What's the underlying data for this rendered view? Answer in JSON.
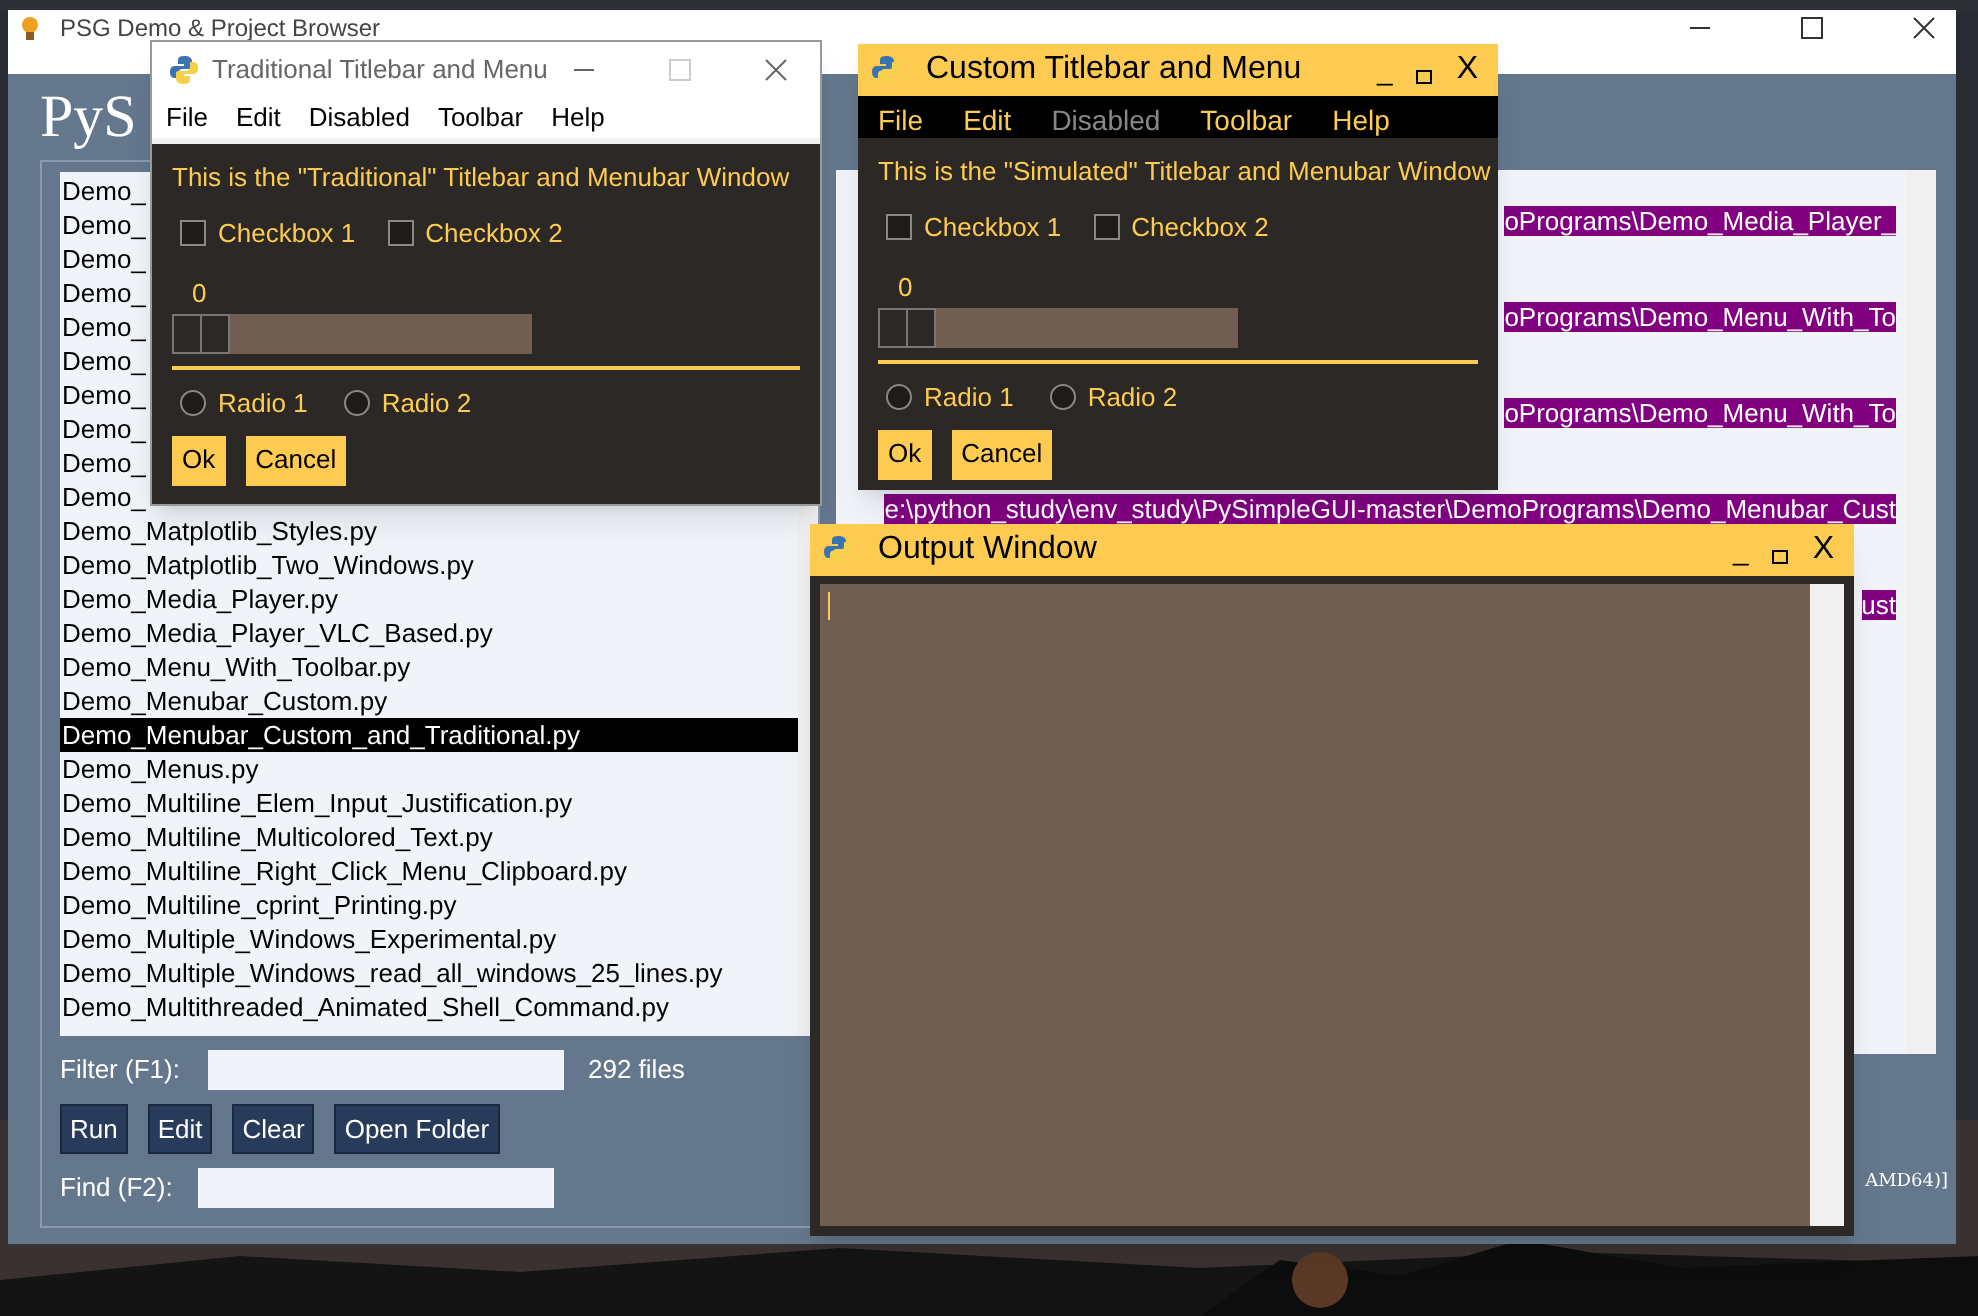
{
  "main_window": {
    "title": "PSG Demo & Project Browser",
    "heading": "PyS",
    "file_list": [
      {
        "text": "Demo_",
        "selected": false
      },
      {
        "text": "Demo_",
        "selected": false
      },
      {
        "text": "Demo_",
        "selected": false
      },
      {
        "text": "Demo_",
        "selected": false
      },
      {
        "text": "Demo_",
        "selected": false
      },
      {
        "text": "Demo_",
        "selected": false
      },
      {
        "text": "Demo_",
        "selected": false
      },
      {
        "text": "Demo_",
        "selected": false
      },
      {
        "text": "Demo_",
        "selected": false
      },
      {
        "text": "Demo_",
        "selected": false
      },
      {
        "text": "Demo_Matplotlib_Styles.py",
        "selected": false
      },
      {
        "text": "Demo_Matplotlib_Two_Windows.py",
        "selected": false
      },
      {
        "text": "Demo_Media_Player.py",
        "selected": false
      },
      {
        "text": "Demo_Media_Player_VLC_Based.py",
        "selected": false
      },
      {
        "text": "Demo_Menu_With_Toolbar.py",
        "selected": false
      },
      {
        "text": "Demo_Menubar_Custom.py",
        "selected": false
      },
      {
        "text": "Demo_Menubar_Custom_and_Traditional.py",
        "selected": true
      },
      {
        "text": "Demo_Menus.py",
        "selected": false
      },
      {
        "text": "Demo_Multiline_Elem_Input_Justification.py",
        "selected": false
      },
      {
        "text": "Demo_Multiline_Multicolored_Text.py",
        "selected": false
      },
      {
        "text": "Demo_Multiline_Right_Click_Menu_Clipboard.py",
        "selected": false
      },
      {
        "text": "Demo_Multiline_cprint_Printing.py",
        "selected": false
      },
      {
        "text": "Demo_Multiple_Windows_Experimental.py",
        "selected": false
      },
      {
        "text": "Demo_Multiple_Windows_read_all_windows_25_lines.py",
        "selected": false
      },
      {
        "text": "Demo_Multithreaded_Animated_Shell_Command.py",
        "selected": false
      }
    ],
    "filter": {
      "label": "Filter (F1):",
      "count": "292 files"
    },
    "buttons": [
      "Run",
      "Edit",
      "Clear",
      "Open Folder"
    ],
    "find": {
      "label": "Find (F2):"
    },
    "output_lines": [
      "oPrograms\\Demo_Media_Player_",
      "oPrograms\\Demo_Menu_With_To",
      "oPrograms\\Demo_Menu_With_To",
      "e:\\python_study\\env_study\\PySimpleGUI-master\\DemoPrograms\\Demo_Menubar_Cust",
      "ust"
    ],
    "output_status": "AMD64)]"
  },
  "traditional_window": {
    "title": "Traditional Titlebar and Menu",
    "menu": [
      {
        "label": "File"
      },
      {
        "label": "Edit"
      },
      {
        "label": "Disabled"
      },
      {
        "label": "Toolbar"
      },
      {
        "label": "Help"
      }
    ],
    "message": "This is the \"Traditional\" Titlebar and Menubar Window",
    "checkboxes": [
      {
        "label": "Checkbox 1",
        "checked": false
      },
      {
        "label": "Checkbox 2",
        "checked": false
      }
    ],
    "slider": {
      "reading": "0",
      "level": 0
    },
    "radios": [
      {
        "label": "Radio 1",
        "selected": false
      },
      {
        "label": "Radio 2",
        "selected": false
      }
    ],
    "buttons": [
      "Ok",
      "Cancel"
    ]
  },
  "custom_window": {
    "title": "Custom Titlebar and Menu",
    "minimize": "_",
    "close": "X",
    "menu": [
      {
        "label": "File",
        "disabled": false
      },
      {
        "label": "Edit",
        "disabled": false
      },
      {
        "label": "Disabled",
        "disabled": true
      },
      {
        "label": "Toolbar",
        "disabled": false
      },
      {
        "label": "Help",
        "disabled": false
      }
    ],
    "message": "This is the \"Simulated\" Titlebar and Menubar Window",
    "checkboxes": [
      {
        "label": "Checkbox 1",
        "checked": false
      },
      {
        "label": "Checkbox 2",
        "checked": false
      }
    ],
    "slider": {
      "reading": "0",
      "level": 0
    },
    "radios": [
      {
        "label": "Radio 1",
        "selected": false
      },
      {
        "label": "Radio 2",
        "selected": false
      }
    ],
    "buttons": [
      "Ok",
      "Cancel"
    ]
  },
  "output_window": {
    "title": "Output Window",
    "minimize": "_",
    "close": "X"
  }
}
